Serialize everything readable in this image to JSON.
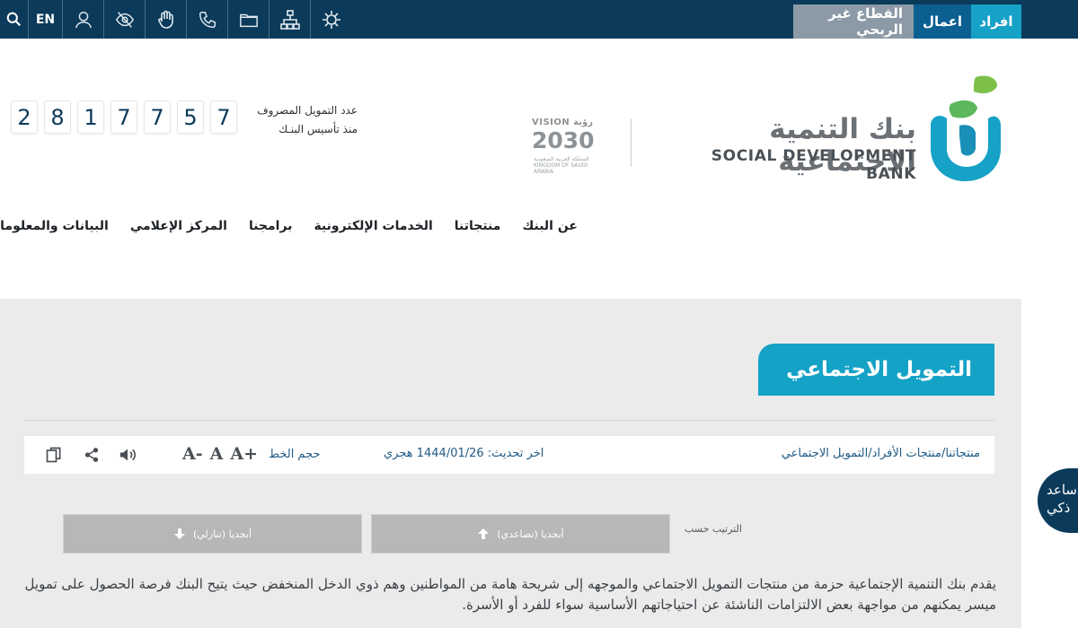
{
  "topbar": {
    "language": "EN",
    "tabs": [
      "افراد",
      "اعمال",
      "القطاع غير الربحي"
    ],
    "icons": [
      "search-icon",
      "user-icon",
      "eye-off-icon",
      "sign-language-icon",
      "phone-icon",
      "folder-icon",
      "sitemap-icon",
      "settings-badge-icon"
    ]
  },
  "header": {
    "bank_name_ar": "بنك التنمية الاجتماعية",
    "bank_name_en": "SOCIAL DEVELOPMENT BANK",
    "vision_top": "VISION رؤية",
    "vision_year": "2030",
    "vision_sub": "المملكة العربية السعودية KINGDOM OF SAUDI ARABIA",
    "counter_label_line1": "عدد التمويل المصروف",
    "counter_label_line2": "منذ تأسيس البنـك",
    "counter_digits": [
      "2",
      "8",
      "1",
      "7",
      "7",
      "5",
      "7"
    ]
  },
  "nav": {
    "items": [
      "عن البنك",
      "منتجاتنا",
      "الخدمات الإلكترونية",
      "برامجنا",
      "المركز الإعلامي",
      "البيانات والمعلومات"
    ]
  },
  "page": {
    "title": "التمويل الاجتماعي",
    "breadcrumb": "منتجاتنا/منتجات الأفراد/التمويل الاجتماعي",
    "last_updated": "اخر تحديث: 1444/01/26 هجري",
    "font_size_label": "حجم الخط",
    "font_buttons": [
      "A+",
      "A",
      "A-"
    ],
    "sort_label": "الترتيب حسب",
    "sort_asc": "أبجديا (تصاعدي)",
    "sort_desc": "أبجديا (تنازلي)",
    "description": "يقدم بنك التنمية الإجتماعية حزمة من منتجات التمويل الاجتماعي والموجهه إلى شريحة هامة من المواطنين وهم ذوي الدخل المنخفض حيث يتيح البنك فرصة الحصول على تمويل ميسر يمكنهم من مواجهة بعض الالتزامات الناشئة عن احتياجاتهم الأساسية سواء للفرد أو الأسرة."
  },
  "assistant": {
    "line1": "ساعد",
    "line2": "ذكي"
  },
  "colors": {
    "topbar": "#0b3a5a",
    "accent": "#15a2c7",
    "business_tab": "#0c5f91",
    "nonprofit_tab": "#8b9aa6",
    "content_bg": "#ebebeb"
  }
}
